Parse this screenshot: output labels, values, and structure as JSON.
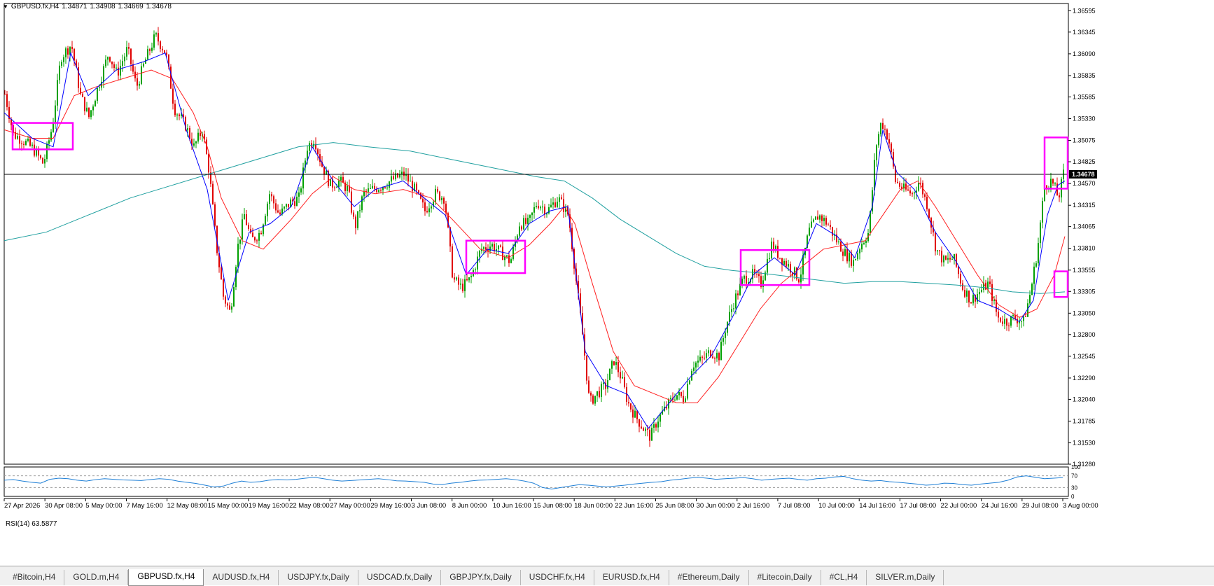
{
  "symbol_header": {
    "symbol": "GBPUSD.fx,H4",
    "open": "1.34871",
    "high": "1.34908",
    "low": "1.34669",
    "close": "1.34678"
  },
  "price_axis": {
    "ticks": [
      "1.36595",
      "1.36345",
      "1.36090",
      "1.35835",
      "1.35585",
      "1.35330",
      "1.35075",
      "1.34825",
      "1.34570",
      "1.34315",
      "1.34065",
      "1.33810",
      "1.33555",
      "1.33305",
      "1.33050",
      "1.32800",
      "1.32545",
      "1.32290",
      "1.32040",
      "1.31785",
      "1.31530",
      "1.31280"
    ],
    "current_price": "1.34678"
  },
  "time_axis": {
    "labels": [
      "27 Apr 2026",
      "30 Apr 08:00",
      "5 May 00:00",
      "7 May 16:00",
      "12 May 08:00",
      "15 May 00:00",
      "19 May 16:00",
      "22 May 08:00",
      "27 May 00:00",
      "29 May 16:00",
      "3 Jun 08:00",
      "8 Jun 00:00",
      "10 Jun 16:00",
      "15 Jun 08:00",
      "18 Jun 00:00",
      "22 Jun 16:00",
      "25 Jun 08:00",
      "30 Jun 00:00",
      "2 Jul 16:00",
      "7 Jul 08:00",
      "10 Jul 00:00",
      "14 Jul 16:00",
      "17 Jul 08:00",
      "22 Jul 00:00",
      "24 Jul 16:00",
      "29 Jul 08:00",
      "3 Aug 00:00"
    ]
  },
  "rsi": {
    "label": "RSI(14) 63.5877",
    "levels": [
      "100",
      "70",
      "30",
      "0"
    ]
  },
  "chart_data": {
    "type": "candlestick",
    "symbol": "GBPUSD.fx",
    "timeframe": "H4",
    "ylim": [
      1.3128,
      1.3668
    ],
    "current_price": 1.34678,
    "price_path": [
      [
        0,
        1.3562
      ],
      [
        12,
        1.3515
      ],
      [
        25,
        1.3508
      ],
      [
        40,
        1.3498
      ],
      [
        55,
        1.348
      ],
      [
        68,
        1.3525
      ],
      [
        80,
        1.3605
      ],
      [
        95,
        1.362
      ],
      [
        108,
        1.356
      ],
      [
        120,
        1.3535
      ],
      [
        135,
        1.3575
      ],
      [
        148,
        1.361
      ],
      [
        160,
        1.3585
      ],
      [
        175,
        1.3615
      ],
      [
        188,
        1.357
      ],
      [
        200,
        1.36
      ],
      [
        215,
        1.363
      ],
      [
        230,
        1.361
      ],
      [
        242,
        1.3545
      ],
      [
        258,
        1.3525
      ],
      [
        270,
        1.35
      ],
      [
        282,
        1.352
      ],
      [
        292,
        1.347
      ],
      [
        302,
        1.3385
      ],
      [
        312,
        1.3325
      ],
      [
        322,
        1.3305
      ],
      [
        332,
        1.338
      ],
      [
        342,
        1.342
      ],
      [
        352,
        1.339
      ],
      [
        365,
        1.34
      ],
      [
        378,
        1.3445
      ],
      [
        392,
        1.342
      ],
      [
        408,
        1.3435
      ],
      [
        420,
        1.344
      ],
      [
        432,
        1.35
      ],
      [
        442,
        1.351
      ],
      [
        452,
        1.348
      ],
      [
        465,
        1.3455
      ],
      [
        478,
        1.346
      ],
      [
        490,
        1.345
      ],
      [
        500,
        1.3405
      ],
      [
        512,
        1.3445
      ],
      [
        525,
        1.345
      ],
      [
        540,
        1.3455
      ],
      [
        555,
        1.3462
      ],
      [
        570,
        1.3468
      ],
      [
        585,
        1.345
      ],
      [
        600,
        1.3425
      ],
      [
        615,
        1.3445
      ],
      [
        628,
        1.344
      ],
      [
        640,
        1.3345
      ],
      [
        652,
        1.3335
      ],
      [
        665,
        1.3345
      ],
      [
        680,
        1.338
      ],
      [
        695,
        1.3385
      ],
      [
        710,
        1.3375
      ],
      [
        722,
        1.3365
      ],
      [
        735,
        1.341
      ],
      [
        748,
        1.341
      ],
      [
        760,
        1.3435
      ],
      [
        775,
        1.3425
      ],
      [
        790,
        1.344
      ],
      [
        805,
        1.342
      ],
      [
        815,
        1.335
      ],
      [
        825,
        1.328
      ],
      [
        835,
        1.32
      ],
      [
        845,
        1.321
      ],
      [
        858,
        1.322
      ],
      [
        870,
        1.325
      ],
      [
        880,
        1.323
      ],
      [
        890,
        1.32
      ],
      [
        900,
        1.3185
      ],
      [
        912,
        1.317
      ],
      [
        922,
        1.316
      ],
      [
        932,
        1.318
      ],
      [
        945,
        1.3195
      ],
      [
        958,
        1.321
      ],
      [
        970,
        1.3205
      ],
      [
        982,
        1.3245
      ],
      [
        995,
        1.325
      ],
      [
        1008,
        1.326
      ],
      [
        1020,
        1.3255
      ],
      [
        1030,
        1.329
      ],
      [
        1042,
        1.332
      ],
      [
        1055,
        1.3345
      ],
      [
        1068,
        1.335
      ],
      [
        1080,
        1.334
      ],
      [
        1095,
        1.3385
      ],
      [
        1108,
        1.337
      ],
      [
        1120,
        1.336
      ],
      [
        1135,
        1.3345
      ],
      [
        1148,
        1.34
      ],
      [
        1162,
        1.342
      ],
      [
        1175,
        1.341
      ],
      [
        1188,
        1.339
      ],
      [
        1200,
        1.3375
      ],
      [
        1212,
        1.3365
      ],
      [
        1222,
        1.3385
      ],
      [
        1234,
        1.34
      ],
      [
        1244,
        1.35
      ],
      [
        1252,
        1.353
      ],
      [
        1262,
        1.351
      ],
      [
        1272,
        1.346
      ],
      [
        1284,
        1.345
      ],
      [
        1296,
        1.3445
      ],
      [
        1306,
        1.346
      ],
      [
        1318,
        1.343
      ],
      [
        1330,
        1.338
      ],
      [
        1342,
        1.3365
      ],
      [
        1355,
        1.337
      ],
      [
        1368,
        1.3335
      ],
      [
        1380,
        1.332
      ],
      [
        1392,
        1.333
      ],
      [
        1405,
        1.334
      ],
      [
        1418,
        1.33
      ],
      [
        1430,
        1.3295
      ],
      [
        1442,
        1.33
      ],
      [
        1455,
        1.3295
      ],
      [
        1465,
        1.333
      ],
      [
        1475,
        1.338
      ],
      [
        1485,
        1.3455
      ],
      [
        1495,
        1.346
      ],
      [
        1505,
        1.344
      ],
      [
        1512,
        1.3468
      ]
    ],
    "lines": {
      "ma_fast_blue": [
        [
          0,
          1.354
        ],
        [
          40,
          1.351
        ],
        [
          70,
          1.35
        ],
        [
          95,
          1.361
        ],
        [
          120,
          1.356
        ],
        [
          160,
          1.359
        ],
        [
          200,
          1.36
        ],
        [
          230,
          1.361
        ],
        [
          260,
          1.352
        ],
        [
          290,
          1.345
        ],
        [
          320,
          1.332
        ],
        [
          350,
          1.34
        ],
        [
          380,
          1.341
        ],
        [
          410,
          1.343
        ],
        [
          440,
          1.35
        ],
        [
          470,
          1.346
        ],
        [
          500,
          1.343
        ],
        [
          530,
          1.345
        ],
        [
          570,
          1.346
        ],
        [
          600,
          1.344
        ],
        [
          630,
          1.342
        ],
        [
          660,
          1.335
        ],
        [
          690,
          1.338
        ],
        [
          720,
          1.3375
        ],
        [
          750,
          1.341
        ],
        [
          780,
          1.3425
        ],
        [
          805,
          1.343
        ],
        [
          830,
          1.326
        ],
        [
          860,
          1.322
        ],
        [
          890,
          1.321
        ],
        [
          920,
          1.317
        ],
        [
          950,
          1.32
        ],
        [
          980,
          1.323
        ],
        [
          1010,
          1.3255
        ],
        [
          1040,
          1.33
        ],
        [
          1070,
          1.335
        ],
        [
          1100,
          1.337
        ],
        [
          1130,
          1.335
        ],
        [
          1160,
          1.341
        ],
        [
          1190,
          1.3395
        ],
        [
          1215,
          1.337
        ],
        [
          1240,
          1.343
        ],
        [
          1255,
          1.352
        ],
        [
          1275,
          1.347
        ],
        [
          1300,
          1.345
        ],
        [
          1330,
          1.34
        ],
        [
          1360,
          1.3365
        ],
        [
          1390,
          1.332
        ],
        [
          1420,
          1.331
        ],
        [
          1450,
          1.3295
        ],
        [
          1470,
          1.332
        ],
        [
          1490,
          1.342
        ],
        [
          1505,
          1.3455
        ],
        [
          1515,
          1.346
        ]
      ],
      "ma_slow_red": [
        [
          0,
          1.352
        ],
        [
          40,
          1.351
        ],
        [
          70,
          1.351
        ],
        [
          100,
          1.356
        ],
        [
          130,
          1.357
        ],
        [
          170,
          1.358
        ],
        [
          210,
          1.359
        ],
        [
          240,
          1.358
        ],
        [
          270,
          1.354
        ],
        [
          290,
          1.35
        ],
        [
          310,
          1.344
        ],
        [
          340,
          1.339
        ],
        [
          370,
          1.338
        ],
        [
          410,
          1.3415
        ],
        [
          440,
          1.3445
        ],
        [
          470,
          1.3465
        ],
        [
          500,
          1.345
        ],
        [
          530,
          1.3445
        ],
        [
          570,
          1.345
        ],
        [
          610,
          1.344
        ],
        [
          640,
          1.3415
        ],
        [
          680,
          1.338
        ],
        [
          720,
          1.337
        ],
        [
          750,
          1.3385
        ],
        [
          780,
          1.341
        ],
        [
          800,
          1.343
        ],
        [
          815,
          1.341
        ],
        [
          840,
          1.334
        ],
        [
          870,
          1.326
        ],
        [
          900,
          1.322
        ],
        [
          930,
          1.321
        ],
        [
          960,
          1.32
        ],
        [
          990,
          1.32
        ],
        [
          1020,
          1.323
        ],
        [
          1050,
          1.327
        ],
        [
          1080,
          1.331
        ],
        [
          1110,
          1.334
        ],
        [
          1140,
          1.336
        ],
        [
          1170,
          1.338
        ],
        [
          1200,
          1.3385
        ],
        [
          1230,
          1.339
        ],
        [
          1255,
          1.342
        ],
        [
          1280,
          1.345
        ],
        [
          1305,
          1.346
        ],
        [
          1330,
          1.343
        ],
        [
          1360,
          1.339
        ],
        [
          1390,
          1.335
        ],
        [
          1420,
          1.3315
        ],
        [
          1450,
          1.33
        ],
        [
          1475,
          1.331
        ],
        [
          1500,
          1.335
        ],
        [
          1515,
          1.3395
        ]
      ],
      "ma_long_teal": [
        [
          0,
          1.339
        ],
        [
          60,
          1.34
        ],
        [
          120,
          1.342
        ],
        [
          180,
          1.344
        ],
        [
          240,
          1.3455
        ],
        [
          300,
          1.347
        ],
        [
          360,
          1.3485
        ],
        [
          420,
          1.35
        ],
        [
          470,
          1.3505
        ],
        [
          520,
          1.35
        ],
        [
          580,
          1.3495
        ],
        [
          640,
          1.3485
        ],
        [
          700,
          1.3475
        ],
        [
          760,
          1.3465
        ],
        [
          800,
          1.346
        ],
        [
          840,
          1.344
        ],
        [
          880,
          1.3415
        ],
        [
          920,
          1.3395
        ],
        [
          960,
          1.3375
        ],
        [
          1000,
          1.336
        ],
        [
          1040,
          1.3355
        ],
        [
          1080,
          1.3352
        ],
        [
          1120,
          1.3348
        ],
        [
          1160,
          1.3344
        ],
        [
          1200,
          1.334
        ],
        [
          1240,
          1.3342
        ],
        [
          1280,
          1.3342
        ],
        [
          1320,
          1.334
        ],
        [
          1360,
          1.3338
        ],
        [
          1400,
          1.3335
        ],
        [
          1440,
          1.333
        ],
        [
          1480,
          1.3328
        ],
        [
          1515,
          1.333
        ]
      ]
    },
    "annotation_boxes": [
      {
        "x0": 12,
        "x1": 98,
        "y0": 1.3497,
        "y1": 1.3528
      },
      {
        "x0": 660,
        "x1": 744,
        "y0": 1.3352,
        "y1": 1.339
      },
      {
        "x0": 1052,
        "x1": 1150,
        "y0": 1.3338,
        "y1": 1.3379
      },
      {
        "x0": 1486,
        "x1": 1519,
        "y0": 1.3451,
        "y1": 1.3511
      },
      {
        "x0": 1500,
        "x1": 1519,
        "y0": 1.3324,
        "y1": 1.3354
      }
    ],
    "rsi_series": [
      55,
      57,
      52,
      48,
      45,
      58,
      62,
      60,
      55,
      52,
      57,
      60,
      58,
      56,
      55,
      54,
      57,
      60,
      58,
      52,
      48,
      44,
      38,
      32,
      35,
      45,
      52,
      48,
      50,
      55,
      57,
      56,
      58,
      62,
      65,
      60,
      55,
      52,
      54,
      56,
      58,
      60,
      57,
      53,
      52,
      50,
      48,
      42,
      40,
      45,
      48,
      52,
      55,
      56,
      58,
      60,
      57,
      52,
      45,
      30,
      25,
      30,
      35,
      40,
      38,
      35,
      32,
      35,
      38,
      42,
      45,
      48,
      50,
      55,
      58,
      62,
      65,
      62,
      58,
      60,
      62,
      64,
      60,
      55,
      58,
      60,
      62,
      58,
      55,
      60,
      62,
      66,
      68,
      60,
      55,
      52,
      54,
      50,
      48,
      45,
      42,
      38,
      40,
      45,
      44,
      40,
      38,
      42,
      45,
      48,
      55,
      66,
      70,
      65,
      60,
      62,
      64
    ]
  },
  "tabs": [
    {
      "label": "#Bitcoin,H4",
      "active": false
    },
    {
      "label": "GOLD.m,H4",
      "active": false
    },
    {
      "label": "GBPUSD.fx,H4",
      "active": true
    },
    {
      "label": "AUDUSD.fx,H4",
      "active": false
    },
    {
      "label": "USDJPY.fx,Daily",
      "active": false
    },
    {
      "label": "USDCAD.fx,Daily",
      "active": false
    },
    {
      "label": "GBPJPY.fx,Daily",
      "active": false
    },
    {
      "label": "USDCHF.fx,H4",
      "active": false
    },
    {
      "label": "EURUSD.fx,H4",
      "active": false
    },
    {
      "label": "#Ethereum,Daily",
      "active": false
    },
    {
      "label": "#Litecoin,Daily",
      "active": false
    },
    {
      "label": "#CL,H4",
      "active": false
    },
    {
      "label": "SILVER.m,Daily",
      "active": false
    }
  ],
  "colors": {
    "bull": "#00a000",
    "bear": "#e00000",
    "ma_fast": "#0000ff",
    "ma_slow": "#ff2020",
    "ma_long": "#20a0a0",
    "annotation": "#ff00ff",
    "rsi": "#1e7fd6",
    "price_line": "#000000",
    "grid": "#000000"
  }
}
